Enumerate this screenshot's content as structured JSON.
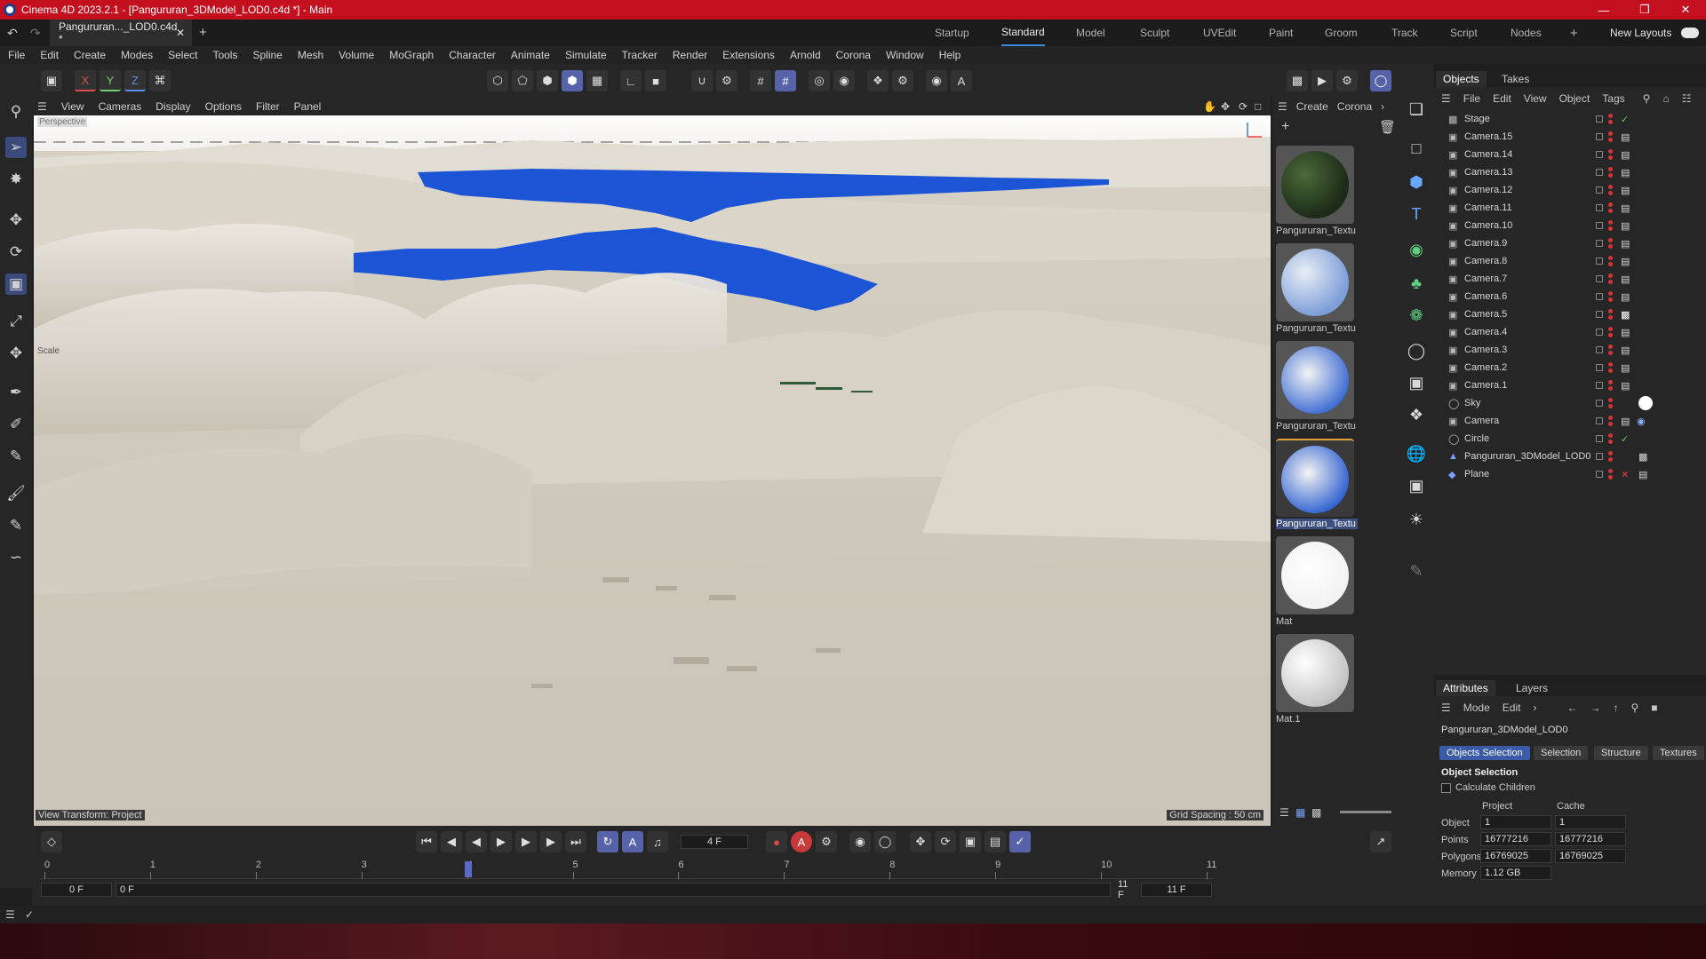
{
  "app": {
    "title": "Cinema 4D 2023.2.1 - [Pangururan_3DModel_LOD0.c4d *] - Main",
    "doc_tab": "Pangururan..._LOD0.c4d *"
  },
  "layouts": [
    "Startup",
    "Standard",
    "Model",
    "Sculpt",
    "UVEdit",
    "Paint",
    "Groom",
    "Track",
    "Script",
    "Nodes"
  ],
  "new_layouts": "New Layouts",
  "menu": [
    "File",
    "Edit",
    "Create",
    "Modes",
    "Select",
    "Tools",
    "Spline",
    "Mesh",
    "Volume",
    "MoGraph",
    "Character",
    "Animate",
    "Simulate",
    "Tracker",
    "Render",
    "Extensions",
    "Arnold",
    "Corona",
    "Window",
    "Help"
  ],
  "axes": [
    "X",
    "Y",
    "Z"
  ],
  "viewport": {
    "menu": [
      "View",
      "Cameras",
      "Display",
      "Options",
      "Filter",
      "Panel"
    ],
    "camera_label": "Perspective",
    "scale_label": "Scale",
    "view_transform": "View Transform: Project",
    "grid_spacing": "Grid Spacing : 50 cm"
  },
  "materials": {
    "menu": [
      "Create",
      "Corona"
    ],
    "items": [
      "Pangururan_Textu",
      "Pangururan_Textu",
      "Pangururan_Textu",
      "Pangururan_Textu",
      "Mat",
      "Mat.1"
    ]
  },
  "objects": {
    "tabs": [
      "Objects",
      "Takes"
    ],
    "menu": [
      "File",
      "Edit",
      "View",
      "Object",
      "Tags"
    ],
    "items": [
      "Stage",
      "Camera.15",
      "Camera.14",
      "Camera.13",
      "Camera.12",
      "Camera.11",
      "Camera.10",
      "Camera.9",
      "Camera.8",
      "Camera.7",
      "Camera.6",
      "Camera.5",
      "Camera.4",
      "Camera.3",
      "Camera.2",
      "Camera.1",
      "Sky",
      "Camera",
      "Circle",
      "Pangururan_3DModel_LOD0",
      "Plane"
    ]
  },
  "attributes": {
    "tabs": [
      "Attributes",
      "Layers"
    ],
    "menu": [
      "Mode",
      "Edit"
    ],
    "object_name": "Pangururan_3DModel_LOD0",
    "subtabs": [
      "Objects Selection",
      "Selection",
      "Structure",
      "Textures"
    ],
    "section": "Object Selection",
    "checkbox": "Calculate Children",
    "col_project": "Project",
    "col_cache": "Cache",
    "rows": [
      {
        "label": "Object",
        "project": "1",
        "cache": "1"
      },
      {
        "label": "Points",
        "project": "16777216",
        "cache": "16777216"
      },
      {
        "label": "Polygons",
        "project": "16769025",
        "cache": "16769025"
      },
      {
        "label": "Memory",
        "project": "1.12 GB",
        "cache": ""
      }
    ]
  },
  "timeline": {
    "frame_field": "4 F",
    "ruler": [
      "0",
      "1",
      "2",
      "3",
      "4",
      "5",
      "6",
      "7",
      "8",
      "9",
      "10",
      "11"
    ],
    "start": "0 F",
    "start2": "0 F",
    "end": "11 F",
    "end2": "11 F",
    "current_frame": 4,
    "max_frame": 11
  }
}
